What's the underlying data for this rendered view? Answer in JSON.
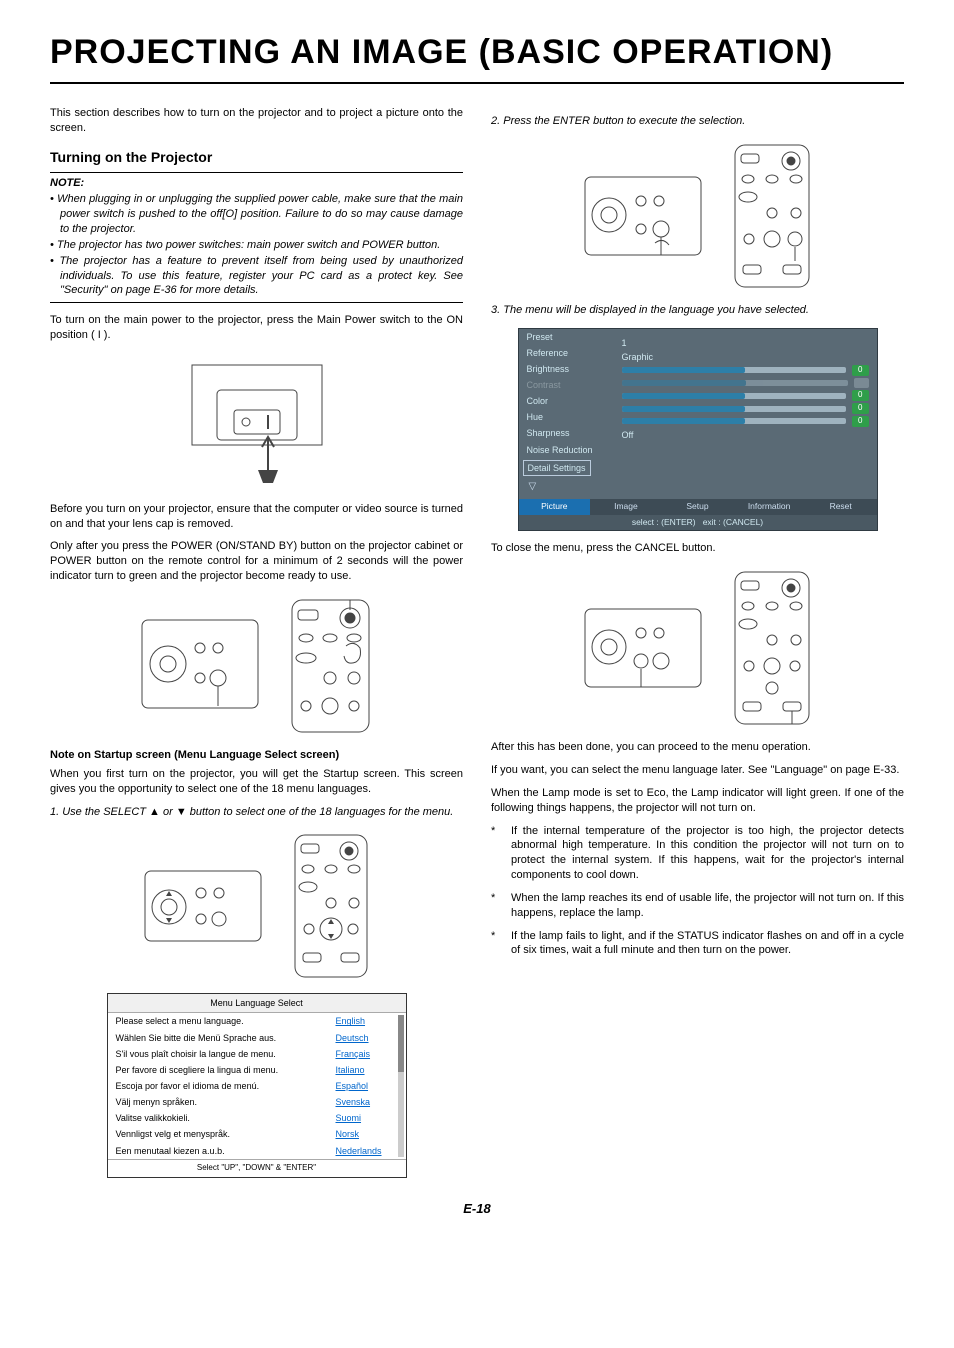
{
  "title": "PROJECTING AN IMAGE (BASIC OPERATION)",
  "intro": "This section describes how to turn on the projector and to project a picture onto the screen.",
  "sectionHeading": "Turning on the Projector",
  "noteLabel": "NOTE:",
  "notes": [
    "When plugging in or unplugging the supplied power cable, make sure that the main power switch is pushed to the off[O] position. Failure to do so may cause damage to the projector.",
    "The projector has two power switches: main power switch and POWER button.",
    "The projector has a feature to prevent itself from being used by unauthorized individuals. To use this feature, register your PC card as a protect key. See \"Security\" on page E-36 for more details."
  ],
  "para1": "To turn on the main power to the projector, press the Main Power switch to the ON position ( I ).",
  "para2": "Before you turn on your projector, ensure that the computer or video source is turned on and that your lens cap is removed.",
  "para3": "Only after you press the POWER (ON/STAND BY) button on the projector cabinet or POWER button on the remote control for a minimum of 2 seconds will the power indicator turn to green and the projector become ready to use.",
  "startupHeading": "Note on Startup screen (Menu Language Select screen)",
  "startupPara": "When you first turn on the projector, you will get the Startup screen. This screen gives you the opportunity to select one of the 18 menu languages.",
  "step1": "1. Use the SELECT ▲ or ▼ button to select one of the 18 languages for the menu.",
  "menuLang": {
    "title": "Menu Language Select",
    "rows": [
      {
        "prompt": "Please select a menu language.",
        "lang": "English"
      },
      {
        "prompt": "Wählen Sie bitte die Menü Sprache aus.",
        "lang": "Deutsch"
      },
      {
        "prompt": "S'il vous plaît choisir la langue de menu.",
        "lang": "Français"
      },
      {
        "prompt": "Per favore di scegliere la lingua di menu.",
        "lang": "Italiano"
      },
      {
        "prompt": "Escoja por favor el idioma de menú.",
        "lang": "Español"
      },
      {
        "prompt": "Välj menyn språken.",
        "lang": "Svenska"
      },
      {
        "prompt": "Valitse valikkokieli.",
        "lang": "Suomi"
      },
      {
        "prompt": "Vennligst velg et menyspråk.",
        "lang": "Norsk"
      },
      {
        "prompt": "Een menutaal kiezen a.u.b.",
        "lang": "Nederlands"
      }
    ],
    "footer": "Select   \"UP\", \"DOWN\"   &   \"ENTER\""
  },
  "step2": "2. Press the ENTER button to execute the selection.",
  "step3": "3. The menu will be displayed in the language you have selected.",
  "osd": {
    "left": [
      {
        "label": "Preset",
        "val": "1"
      },
      {
        "label": "Reference",
        "val": "Graphic"
      },
      {
        "label": "Brightness",
        "val": "0",
        "slider": true
      },
      {
        "label": "Contrast",
        "dim": true,
        "slider": true
      },
      {
        "label": "Color",
        "val": "0",
        "slider": true
      },
      {
        "label": "Hue",
        "val": "0",
        "slider": true
      },
      {
        "label": "Sharpness",
        "val": "0",
        "slider": true
      },
      {
        "label": "Noise Reduction",
        "val": "Off"
      },
      {
        "label": "Detail Settings",
        "boxed": true
      }
    ],
    "tabs": [
      "Picture",
      "Image",
      "Setup",
      "Information",
      "Reset"
    ],
    "footer": {
      "select": "select : (ENTER)",
      "exit": "exit : (CANCEL)"
    }
  },
  "closePara": "To close the menu, press the CANCEL button.",
  "afterPara1": "After this has been done, you can proceed to the menu operation.",
  "afterPara2": "If you want, you can select the menu language later. See \"Language\" on page E-33.",
  "lampPara": "When the Lamp mode is set to Eco, the Lamp indicator will light green. If one of the following things happens, the projector will not turn on.",
  "bullets": [
    "If the internal temperature of the projector is too high, the projector detects abnormal high temperature. In this condition the projector will not turn on to protect the internal system. If this happens, wait for the projector's internal components to cool down.",
    "When the lamp reaches its end of usable life, the projector will not turn on. If this happens, replace the lamp.",
    "If the lamp fails to light, and if the STATUS indicator flashes on and off in a cycle of six times, wait a full minute and then turn on the power."
  ],
  "pageNum": "E-18"
}
